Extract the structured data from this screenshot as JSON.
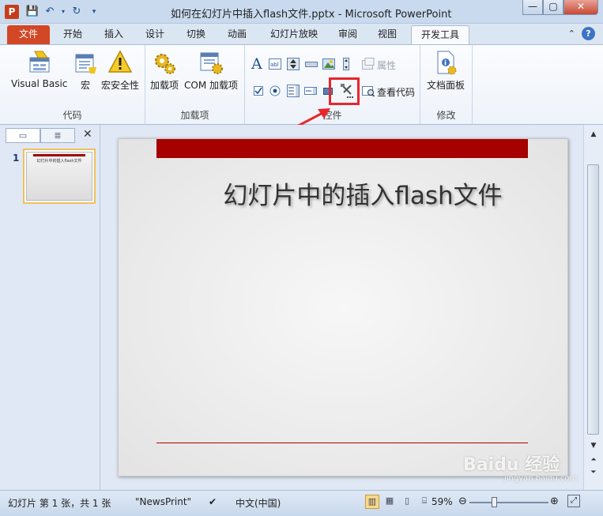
{
  "window": {
    "title": "如何在幻灯片中插入flash文件.pptx - Microsoft PowerPoint",
    "app_icon_letter": "P",
    "controls": {
      "minimize": "—",
      "maximize": "▢",
      "close": "✕"
    }
  },
  "tabs": [
    {
      "label": "文件"
    },
    {
      "label": "开始"
    },
    {
      "label": "插入"
    },
    {
      "label": "设计"
    },
    {
      "label": "切换"
    },
    {
      "label": "动画"
    },
    {
      "label": "幻灯片放映"
    },
    {
      "label": "审阅"
    },
    {
      "label": "视图"
    },
    {
      "label": "开发工具"
    }
  ],
  "active_tab": "开发工具",
  "help_symbol": "?",
  "ribbon": {
    "code_group": {
      "label": "代码",
      "buttons": [
        {
          "label": "Visual Basic"
        },
        {
          "label": "宏"
        },
        {
          "label": "宏安全性"
        }
      ]
    },
    "addins_group": {
      "label": "加载项",
      "buttons": [
        {
          "label": "加载项"
        },
        {
          "label": "COM 加载项"
        }
      ]
    },
    "controls_group": {
      "label": "控件",
      "properties_label": "属性",
      "view_code_label": "查看代码"
    },
    "modify_group": {
      "label": "修改",
      "buttons": [
        {
          "label": "文档面板"
        }
      ]
    }
  },
  "left_panel": {
    "close_symbol": "✕",
    "slide_number": "1",
    "thumb_title": "幻灯片中的插入flash文件"
  },
  "slide": {
    "title": "幻灯片中的插入flash文件"
  },
  "statusbar": {
    "slide_info": "幻灯片 第 1 张，共 1 张",
    "theme": "\"NewsPrint\"",
    "language": "中文(中国)",
    "zoom": "59%",
    "zoom_level": 0.59
  },
  "watermark": {
    "text": "Baidu 经验",
    "sub": "jingyan.baidu.com"
  },
  "colors": {
    "file_tab": "#d24726",
    "accent_bar": "#a60000",
    "highlight": "#e8262c"
  }
}
